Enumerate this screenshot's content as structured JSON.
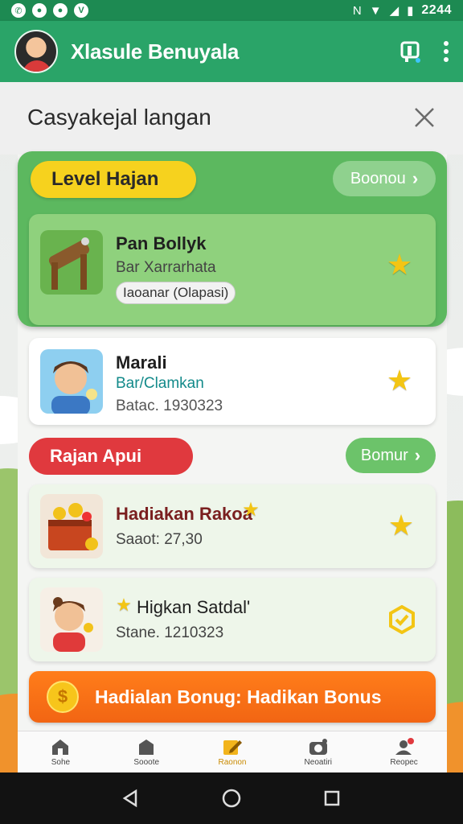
{
  "status_bar": {
    "left_icons": [
      "whatsapp-icon",
      "notification-icon",
      "notification-icon",
      "vine-icon"
    ],
    "time": "2244"
  },
  "app_bar": {
    "title": "Xlasule Benuyala"
  },
  "sheet": {
    "title": "Casyakejal langan"
  },
  "section_1": {
    "pill_label": "Level Hajan",
    "action_label": "Boonou",
    "items": [
      {
        "name": "Pan Bollyk",
        "subtitle": "Bar Xarrarhata",
        "tag": "Iaoanar (Olapasi)"
      },
      {
        "name": "Marali",
        "subtitle": "Bar/Clamkan",
        "detail": "Batac. 1930323"
      }
    ]
  },
  "section_2": {
    "pill_label": "Rajan Apui",
    "action_label": "Bomur",
    "items": [
      {
        "name": "Hadiakan Rakoa",
        "detail": "Saaot: 27,30"
      },
      {
        "name": "Higkan Satdal'",
        "detail": "Stane. 1210323"
      }
    ]
  },
  "banner": {
    "text": "Hadialan Bonug: Hadikan Bonus"
  },
  "bottom_nav": [
    {
      "label": "Sohe",
      "icon": "home-icon"
    },
    {
      "label": "Sooote",
      "icon": "shop-icon"
    },
    {
      "label": "Raonon",
      "icon": "edit-icon"
    },
    {
      "label": "Neoatiri",
      "icon": "camera-icon"
    },
    {
      "label": "Reopec",
      "icon": "profile-icon"
    }
  ],
  "colors": {
    "primary": "#2aa468",
    "status_bar": "#1d8a52",
    "group_green": "#5cb85f",
    "pill_yellow": "#f6d21e",
    "pill_red": "#e0393e",
    "banner_orange": "#f26513",
    "star": "#f3c514"
  }
}
